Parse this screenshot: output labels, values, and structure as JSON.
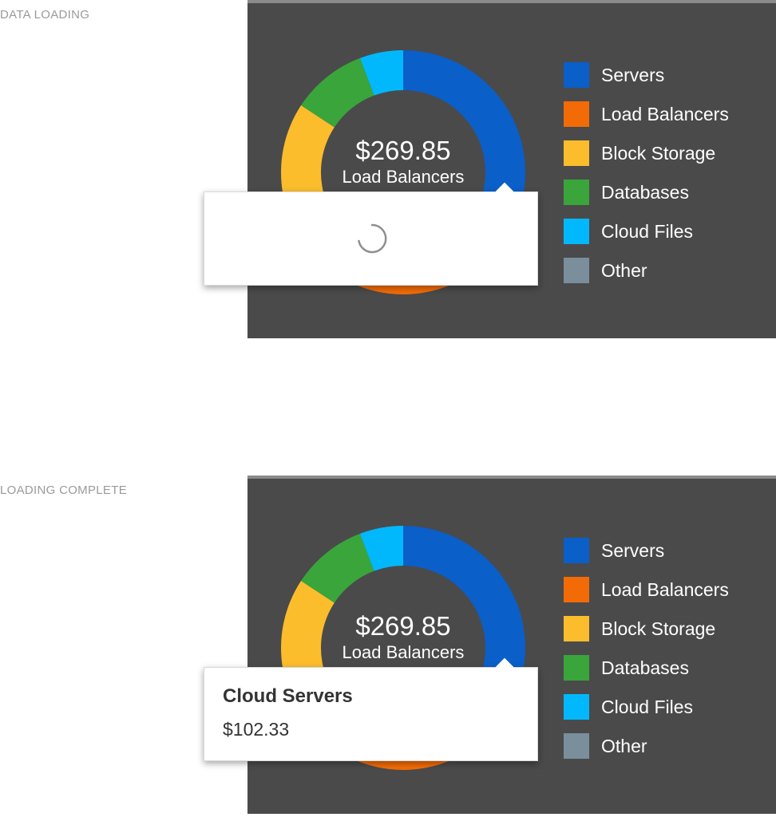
{
  "states": [
    {
      "label": "DATA LOADING",
      "total": "$269.85",
      "center_label": "Load Balancers",
      "tooltip": {
        "loading": true,
        "title": "",
        "value": ""
      }
    },
    {
      "label": "LOADING COMPLETE",
      "total": "$269.85",
      "center_label": "Load Balancers",
      "tooltip": {
        "loading": false,
        "title": "Cloud Servers",
        "value": "$102.33"
      }
    }
  ],
  "colors": {
    "panel_bg": "#4a4a4a",
    "tooltip_bg": "#ffffff"
  },
  "chart_data": [
    {
      "type": "pie",
      "variant": "donut",
      "center_text": "$269.85",
      "center_subtext": "Load Balancers",
      "categories": [
        "Servers",
        "Load Balancers",
        "Block Storage",
        "Databases",
        "Cloud Files",
        "Other"
      ],
      "values": [
        102.33,
        60,
        65,
        27,
        15.52,
        0
      ],
      "colors": [
        "#0a5fc9",
        "#f36b06",
        "#fbbd2c",
        "#3aa53a",
        "#02b8fc",
        "#7a8e9c"
      ],
      "legend_position": "right"
    },
    {
      "type": "pie",
      "variant": "donut",
      "center_text": "$269.85",
      "center_subtext": "Load Balancers",
      "categories": [
        "Servers",
        "Load Balancers",
        "Block Storage",
        "Databases",
        "Cloud Files",
        "Other"
      ],
      "values": [
        102.33,
        60,
        65,
        27,
        15.52,
        0
      ],
      "colors": [
        "#0a5fc9",
        "#f36b06",
        "#fbbd2c",
        "#3aa53a",
        "#02b8fc",
        "#7a8e9c"
      ],
      "legend_position": "right"
    }
  ]
}
